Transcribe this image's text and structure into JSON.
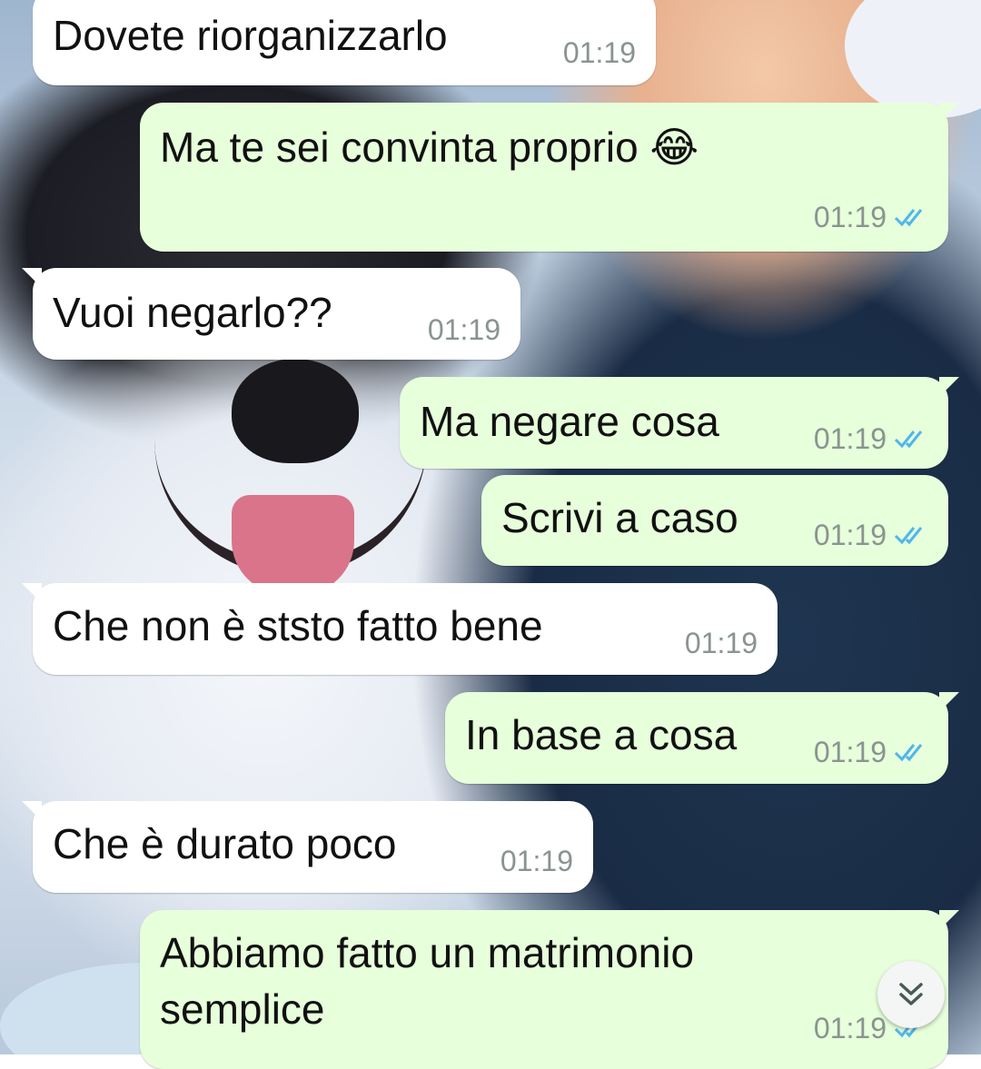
{
  "wallpaper": {
    "description_icon": "husky-wallpaper"
  },
  "messages": [
    {
      "direction": "incoming",
      "text": "Dovete riorganizzarlo",
      "time": "01:19"
    },
    {
      "direction": "outgoing",
      "text": "Ma te sei convinta proprio 😂",
      "time": "01:19",
      "status": "read"
    },
    {
      "direction": "incoming",
      "text": "Vuoi negarlo??",
      "time": "01:19"
    },
    {
      "direction": "outgoing",
      "text": "Ma negare cosa",
      "time": "01:19",
      "status": "read"
    },
    {
      "direction": "outgoing",
      "text": "Scrivi a caso",
      "time": "01:19",
      "status": "read"
    },
    {
      "direction": "incoming",
      "text": "Che non è ststo fatto bene",
      "time": "01:19"
    },
    {
      "direction": "outgoing",
      "text": "In base a cosa",
      "time": "01:19",
      "status": "read"
    },
    {
      "direction": "incoming",
      "text": "Che è durato poco",
      "time": "01:19"
    },
    {
      "direction": "outgoing",
      "text_lines": [
        "Abbiamo fatto un matrimonio",
        "semplice"
      ],
      "time": "01:19",
      "status": "read"
    }
  ],
  "colors": {
    "incoming_bubble": "#ffffff",
    "outgoing_bubble": "#e7ffdb",
    "read_ticks": "#4fb6ec",
    "timestamp": "#8a948f"
  },
  "scroll_down": {
    "icon": "double-chevron-down-icon"
  }
}
